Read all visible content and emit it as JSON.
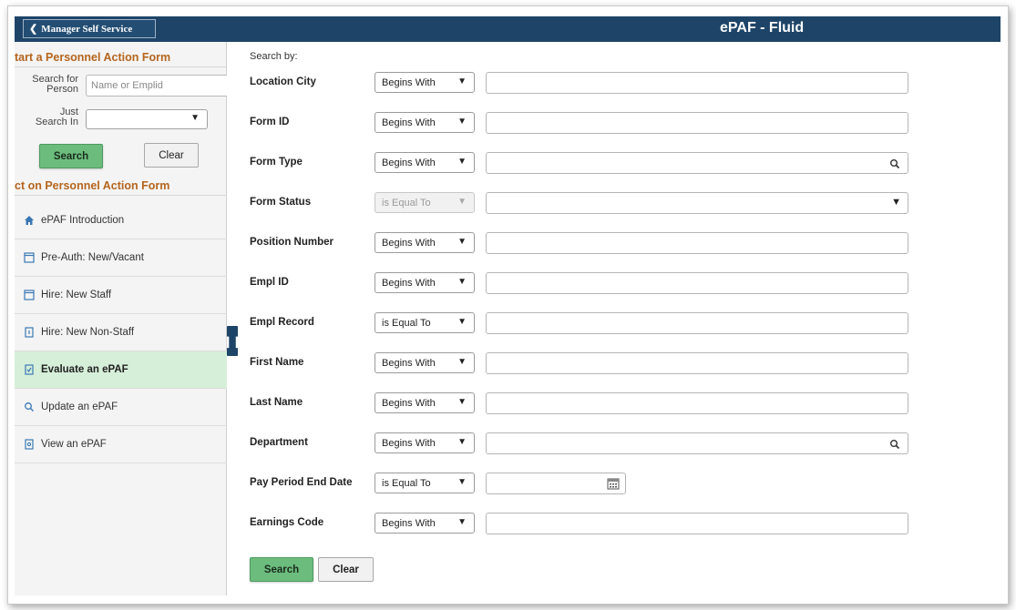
{
  "header": {
    "back_label": "Manager Self Service",
    "title": "ePAF - Fluid"
  },
  "left_panel": {
    "start_section_title": "tart a Personnel Action Form",
    "search_for_label_1": "Search for",
    "search_for_label_2": "Person",
    "search_placeholder": "Name or Emplid",
    "just_search_label_1": "Just",
    "just_search_label_2": "Search In",
    "search_button": "Search",
    "clear_button": "Clear",
    "act_section_title": "ct on Personnel Action Form",
    "nav_items": [
      {
        "label": "ePAF Introduction",
        "icon": "home-icon"
      },
      {
        "label": "Pre-Auth: New/Vacant",
        "icon": "form-icon"
      },
      {
        "label": "Hire: New Staff",
        "icon": "form-icon"
      },
      {
        "label": "Hire: New Non-Staff",
        "icon": "form-add-icon"
      },
      {
        "label": "Evaluate an ePAF",
        "icon": "form-check-icon",
        "active": true
      },
      {
        "label": "Update an ePAF",
        "icon": "search-icon"
      },
      {
        "label": "View an ePAF",
        "icon": "form-view-icon"
      }
    ]
  },
  "main": {
    "search_by_label": "Search by:",
    "criteria": [
      {
        "label": "Location City",
        "operator": "Begins With",
        "field": "text"
      },
      {
        "label": "Form ID",
        "operator": "Begins With",
        "field": "text"
      },
      {
        "label": "Form Type",
        "operator": "Begins With",
        "field": "lookup"
      },
      {
        "label": "Form Status",
        "operator": "is Equal To",
        "field": "select",
        "disabled": true
      },
      {
        "label": "Position Number",
        "operator": "Begins With",
        "field": "text"
      },
      {
        "label": "Empl ID",
        "operator": "Begins With",
        "field": "text"
      },
      {
        "label": "Empl Record",
        "operator": "is Equal To",
        "field": "text"
      },
      {
        "label": "First Name",
        "operator": "Begins With",
        "field": "text"
      },
      {
        "label": "Last Name",
        "operator": "Begins With",
        "field": "text"
      },
      {
        "label": "Department",
        "operator": "Begins With",
        "field": "lookup"
      },
      {
        "label": "Pay Period End Date",
        "operator": "is Equal To",
        "field": "date"
      },
      {
        "label": "Earnings Code",
        "operator": "Begins With",
        "field": "text"
      }
    ],
    "search_button": "Search",
    "clear_button": "Clear"
  },
  "colors": {
    "banner": "#1e4568",
    "section_heading": "#b5651d",
    "primary_button": "#6cbd7d",
    "active_nav": "#d6efd9"
  }
}
